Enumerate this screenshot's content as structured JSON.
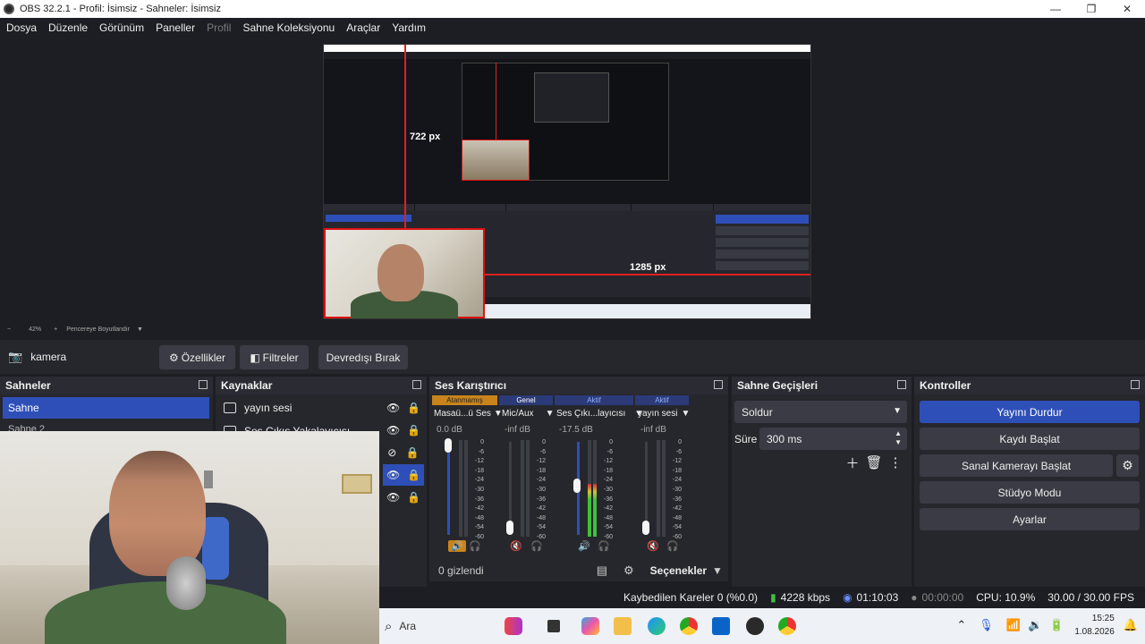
{
  "window": {
    "title": "OBS 32.2.1 - Profil: İsimsiz - Sahneler: İsimsiz",
    "minimize_icon": "minimize-icon",
    "maximize_icon": "maximize-icon",
    "close_icon": "close-icon"
  },
  "menu": [
    "Dosya",
    "Düzenle",
    "Görünüm",
    "Paneller",
    "Profil",
    "Sahne Koleksiyonu",
    "Araçlar",
    "Yardım"
  ],
  "preview": {
    "height_label": "722 px",
    "width_label": "1285 px"
  },
  "zoom": {
    "minus": "−",
    "value": "42%",
    "plus": "+",
    "fit_label": "Pencereye Boyutlandır"
  },
  "source_toolbar": {
    "source_name": "kamera",
    "properties": "Özellikler",
    "filters": "Filtreler",
    "deactivate": "Devredışı Bırak"
  },
  "scenes": {
    "title": "Sahneler",
    "items": [
      "Sahne",
      "Sahne 2"
    ]
  },
  "sources": {
    "title": "Kaynaklar",
    "items": [
      {
        "name": "yayın sesi"
      },
      {
        "name": "Ses Çıkış Yakalayıcısı"
      }
    ]
  },
  "mixer": {
    "title": "Ses Karıştırıcı",
    "tags": [
      "Atanmamış",
      "Genel",
      "Aktif",
      "Aktif"
    ],
    "channels": [
      {
        "name": "Masaü...ü Ses",
        "db": "0.0 dB",
        "level": 0.0
      },
      {
        "name": "Mic/Aux",
        "db": "-inf dB",
        "level": 0.0
      },
      {
        "name": "Ses Çıkı...layıcısı",
        "db": "-17.5 dB",
        "level": 0.55
      },
      {
        "name": "yayın sesi",
        "db": "-inf dB",
        "level": 0.0
      }
    ],
    "scale": [
      "0",
      "-6",
      "-12",
      "-18",
      "-24",
      "-30",
      "-36",
      "-42",
      "-48",
      "-54",
      "-60"
    ],
    "hidden_label": "0 gizlendi",
    "options_label": "Seçenekler"
  },
  "transitions": {
    "title": "Sahne Geçişleri",
    "selected": "Soldur",
    "duration_label": "Süre",
    "duration_value": "300 ms"
  },
  "controls": {
    "title": "Kontroller",
    "stop_stream": "Yayını Durdur",
    "start_record": "Kaydı Başlat",
    "start_vcam": "Sanal Kamerayı Başlat",
    "studio_mode": "Stüdyo Modu",
    "settings": "Ayarlar"
  },
  "status": {
    "dropped": "Kaybedilen Kareler 0 (%0.0)",
    "bitrate": "4228 kbps",
    "stream_time": "01:10:03",
    "record_time": "00:00:00",
    "cpu": "CPU: 10.9%",
    "fps": "30.00 / 30.00 FPS"
  },
  "taskbar": {
    "search_placeholder": "Ara",
    "time": "15:25",
    "date": "1.08.2026"
  },
  "colors": {
    "accent": "#2f4fb8",
    "panel": "#26272d",
    "background": "#1d1e24",
    "meter_green": "#3fbf3f",
    "tag_orange": "#c8841a",
    "measure_red": "#e02020"
  }
}
